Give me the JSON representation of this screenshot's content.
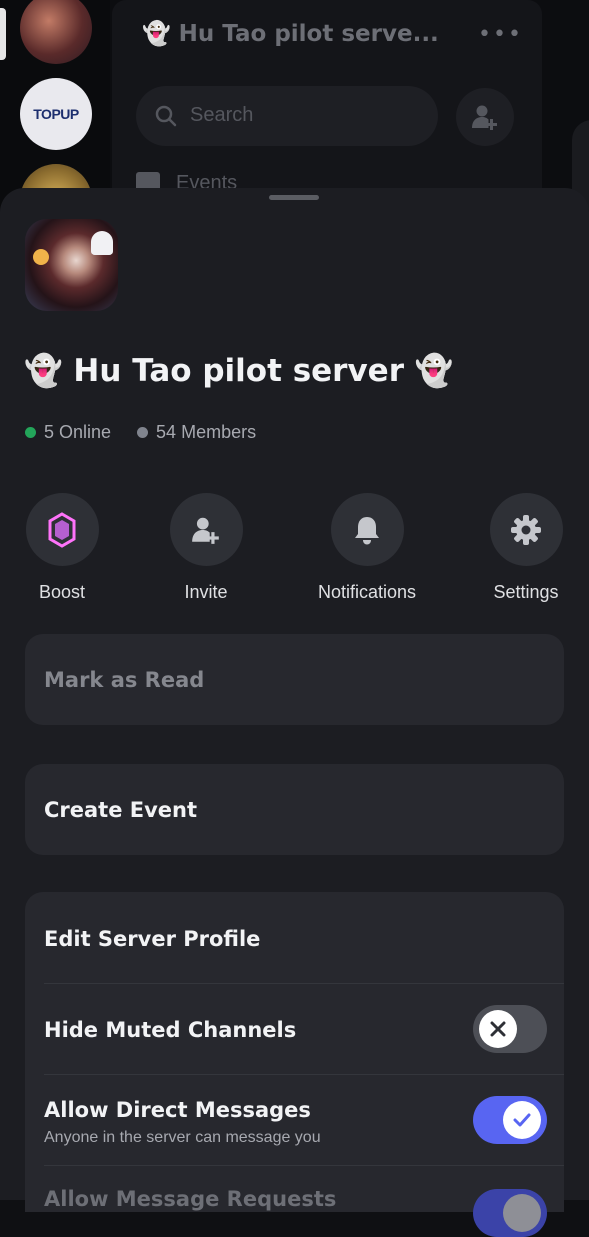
{
  "background": {
    "channel_title": "👻 Hu Tao pilot serve...",
    "search_placeholder": "Search",
    "events_label": "Events",
    "guild_2_label": "TOPUP"
  },
  "server": {
    "name": "👻 Hu Tao pilot server 👻",
    "online": "5 Online",
    "members": "54 Members"
  },
  "actions": [
    {
      "label": "Boost",
      "icon": "boost-gem-icon"
    },
    {
      "label": "Invite",
      "icon": "add-user-icon"
    },
    {
      "label": "Notifications",
      "icon": "bell-icon"
    },
    {
      "label": "Settings",
      "icon": "gear-icon"
    }
  ],
  "menu": {
    "mark_as_read": "Mark as Read",
    "create_event": "Create Event",
    "edit_server_profile": "Edit Server Profile",
    "hide_muted_channels": "Hide Muted Channels",
    "allow_direct_messages": "Allow Direct Messages",
    "allow_direct_messages_sub": "Anyone in the server can message you",
    "allow_message_requests": "Allow Message Requests"
  },
  "toggles": {
    "hide_muted_channels": false,
    "allow_direct_messages": true,
    "allow_message_requests": true
  },
  "colors": {
    "accent": "#5865f2",
    "online": "#23a55a",
    "boost": "#ff73fa"
  }
}
